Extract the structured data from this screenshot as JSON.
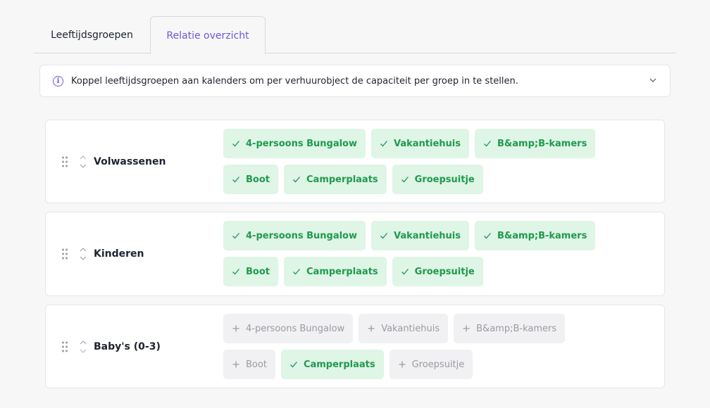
{
  "tabs": [
    {
      "label": "Leeftijdsgroepen",
      "active": false
    },
    {
      "label": "Relatie overzicht",
      "active": true
    }
  ],
  "info": {
    "text": "Koppel leeftijdsgroepen aan kalenders om per verhuurobject de capaciteit per groep in te stellen."
  },
  "colors": {
    "accent": "#6a5ad6",
    "linked_bg": "#dff5e6",
    "linked_text": "#1f9a4e",
    "unlinked_bg": "#f1f1f3",
    "unlinked_text": "#9a9aa3"
  },
  "groups": [
    {
      "name": "Volwassenen",
      "calendars": [
        {
          "label": "4-persoons Bungalow",
          "linked": true
        },
        {
          "label": "Vakantiehuis",
          "linked": true
        },
        {
          "label": "B&amp;B-kamers",
          "linked": true
        },
        {
          "label": "Boot",
          "linked": true
        },
        {
          "label": "Camperplaats",
          "linked": true
        },
        {
          "label": "Groepsuitje",
          "linked": true
        }
      ]
    },
    {
      "name": "Kinderen",
      "calendars": [
        {
          "label": "4-persoons Bungalow",
          "linked": true
        },
        {
          "label": "Vakantiehuis",
          "linked": true
        },
        {
          "label": "B&amp;B-kamers",
          "linked": true
        },
        {
          "label": "Boot",
          "linked": true
        },
        {
          "label": "Camperplaats",
          "linked": true
        },
        {
          "label": "Groepsuitje",
          "linked": true
        }
      ]
    },
    {
      "name": "Baby's (0-3)",
      "calendars": [
        {
          "label": "4-persoons Bungalow",
          "linked": false
        },
        {
          "label": "Vakantiehuis",
          "linked": false
        },
        {
          "label": "B&amp;B-kamers",
          "linked": false
        },
        {
          "label": "Boot",
          "linked": false
        },
        {
          "label": "Camperplaats",
          "linked": true
        },
        {
          "label": "Groepsuitje",
          "linked": false
        }
      ]
    }
  ]
}
